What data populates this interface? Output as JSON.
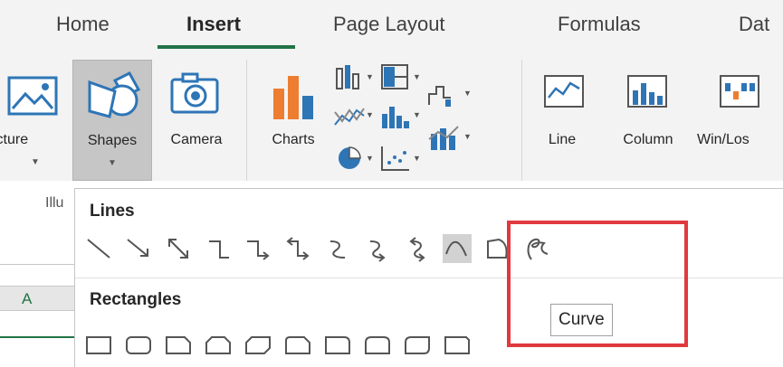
{
  "tabs": {
    "home": "Home",
    "insert": "Insert",
    "page_layout": "Page Layout",
    "formulas": "Formulas",
    "data": "Dat"
  },
  "ribbon": {
    "picture": "icture",
    "shapes": "Shapes",
    "camera": "Camera",
    "charts": "Charts",
    "line": "Line",
    "column": "Column",
    "winloss": "Win/Los",
    "group_label": "Illu"
  },
  "dropdown": {
    "lines_title": "Lines",
    "rectangles_title": "Rectangles",
    "tooltip": "Curve"
  },
  "sheet": {
    "column_a": "A"
  },
  "colors": {
    "accent": "#217346",
    "highlight": "#e0393e",
    "blue": "#2e75b6",
    "orange": "#ed7d31"
  }
}
